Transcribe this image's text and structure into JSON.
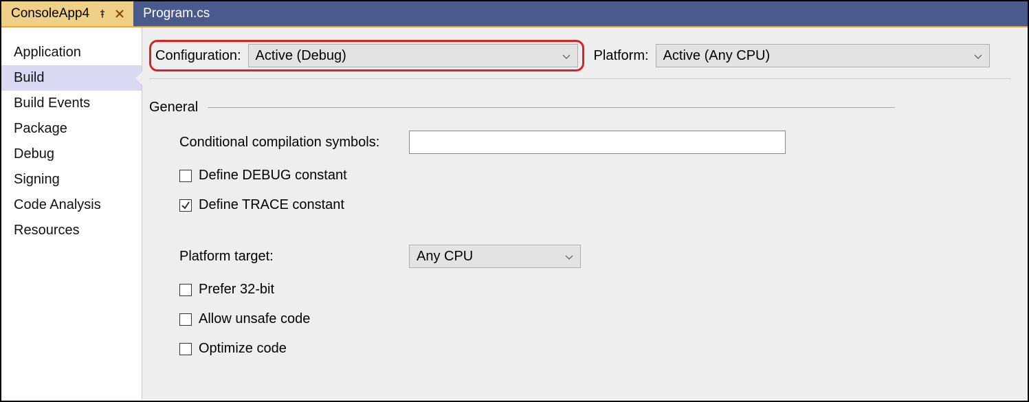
{
  "tabs": {
    "active": {
      "label": "ConsoleApp4"
    },
    "inactive": {
      "label": "Program.cs"
    }
  },
  "sidebar": {
    "items": [
      {
        "label": "Application",
        "selected": false
      },
      {
        "label": "Build",
        "selected": true
      },
      {
        "label": "Build Events",
        "selected": false
      },
      {
        "label": "Package",
        "selected": false
      },
      {
        "label": "Debug",
        "selected": false
      },
      {
        "label": "Signing",
        "selected": false
      },
      {
        "label": "Code Analysis",
        "selected": false
      },
      {
        "label": "Resources",
        "selected": false
      }
    ]
  },
  "toolbar": {
    "configuration_label": "Configuration:",
    "configuration_value": "Active (Debug)",
    "platform_label": "Platform:",
    "platform_value": "Active (Any CPU)"
  },
  "section": {
    "general_title": "General",
    "conditional_symbols_label": "Conditional compilation symbols:",
    "conditional_symbols_value": "",
    "define_debug_label": "Define DEBUG constant",
    "define_debug_checked": false,
    "define_trace_label": "Define TRACE constant",
    "define_trace_checked": true,
    "platform_target_label": "Platform target:",
    "platform_target_value": "Any CPU",
    "prefer_32bit_label": "Prefer 32-bit",
    "prefer_32bit_checked": false,
    "allow_unsafe_label": "Allow unsafe code",
    "allow_unsafe_checked": false,
    "optimize_label": "Optimize code",
    "optimize_checked": false
  }
}
